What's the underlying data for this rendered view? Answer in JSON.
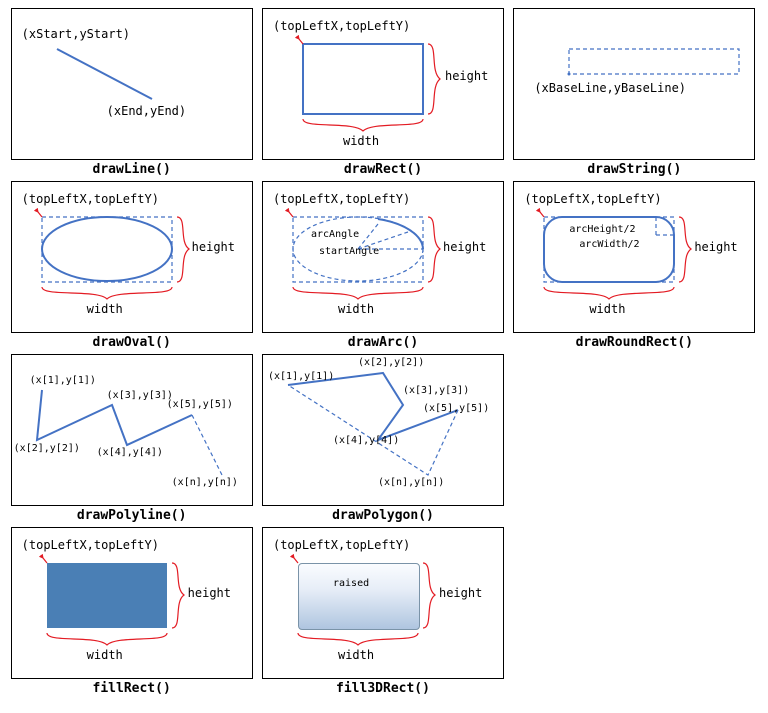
{
  "panels": [
    {
      "caption": "drawLine()",
      "labels": {
        "start": "(xStart,yStart)",
        "end": "(xEnd,yEnd)"
      }
    },
    {
      "caption": "drawRect()",
      "labels": {
        "topleft": "(topLeftX,topLeftY)",
        "width": "width",
        "height": "height"
      }
    },
    {
      "caption": "drawString()",
      "labels": {
        "baseline": "(xBaseLine,yBaseLine)"
      }
    },
    {
      "caption": "drawOval()",
      "labels": {
        "topleft": "(topLeftX,topLeftY)",
        "width": "width",
        "height": "height"
      }
    },
    {
      "caption": "drawArc()",
      "labels": {
        "topleft": "(topLeftX,topLeftY)",
        "width": "width",
        "height": "height",
        "arcAngle": "arcAngle",
        "startAngle": "startAngle"
      }
    },
    {
      "caption": "drawRoundRect()",
      "labels": {
        "topleft": "(topLeftX,topLeftY)",
        "width": "width",
        "height": "height",
        "arcHeight": "arcHeight/2",
        "arcWidth": "arcWidth/2"
      }
    },
    {
      "caption": "drawPolyline()",
      "labels": {
        "p1": "(x[1],y[1])",
        "p2": "(x[2],y[2])",
        "p3": "(x[3],y[3])",
        "p4": "(x[4],y[4])",
        "p5": "(x[5],y[5])",
        "pn": "(x[n],y[n])"
      }
    },
    {
      "caption": "drawPolygon()",
      "labels": {
        "p1": "(x[1],y[1])",
        "p2": "(x[2],y[2])",
        "p3": "(x[3],y[3])",
        "p4": "(x[4],y[4])",
        "p5": "(x[5],y[5])",
        "pn": "(x[n],y[n])"
      }
    },
    {
      "caption": "fillRect()",
      "labels": {
        "topleft": "(topLeftX,topLeftY)",
        "width": "width",
        "height": "height"
      }
    },
    {
      "caption": "fill3DRect()",
      "labels": {
        "topleft": "(topLeftX,topLeftY)",
        "width": "width",
        "height": "height",
        "raised": "raised"
      }
    }
  ],
  "colors": {
    "accent": "#4472C4",
    "bracket": "#E31B23",
    "fill": "#4A7FB5"
  },
  "chart_data": null
}
